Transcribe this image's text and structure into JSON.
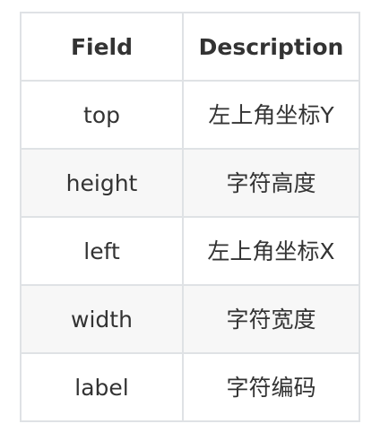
{
  "table": {
    "headers": [
      "Field",
      "Description"
    ],
    "rows": [
      [
        "top",
        "左上角坐标Y"
      ],
      [
        "height",
        "字符高度"
      ],
      [
        "left",
        "左上角坐标X"
      ],
      [
        "width",
        "字符宽度"
      ],
      [
        "label",
        "字符编码"
      ]
    ]
  }
}
